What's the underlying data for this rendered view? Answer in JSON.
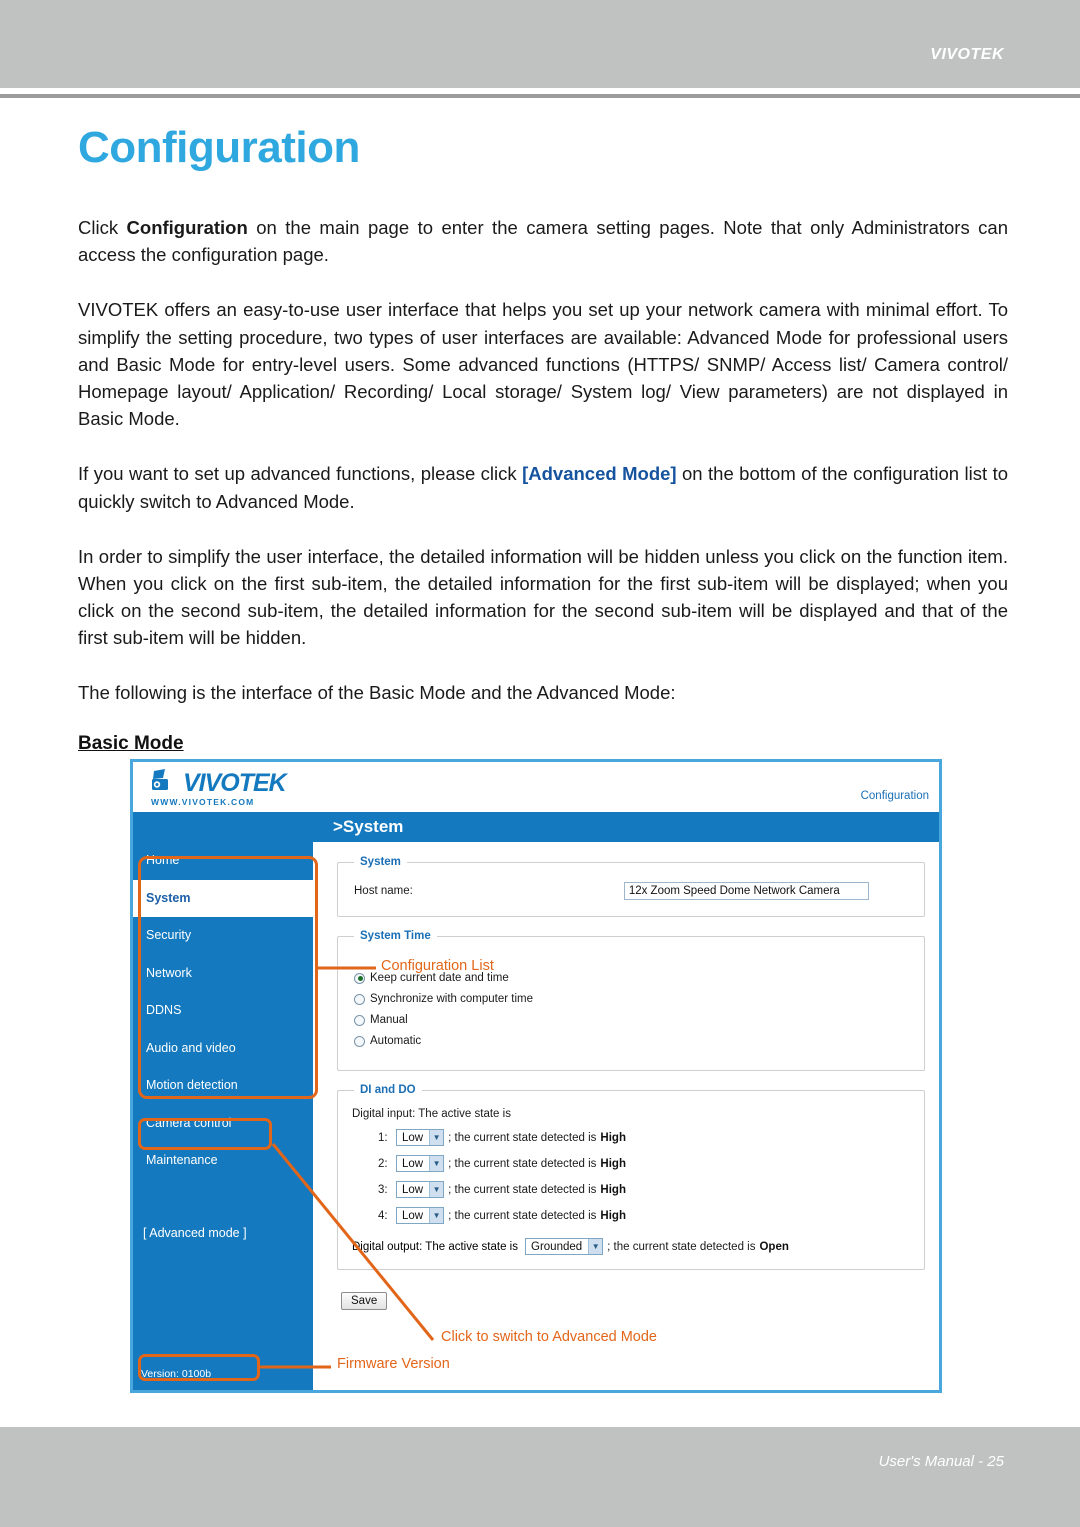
{
  "page_header": {
    "brand": "VIVOTEK"
  },
  "page_footer": {
    "manual": "User's Manual - 25"
  },
  "document": {
    "title": "Configuration",
    "paragraphs": [
      "Click Configuration on the main page to enter the camera setting pages. Note that only Administrators can access the configuration page.",
      "VIVOTEK offers an easy-to-use user interface that helps you set up your network camera with minimal effort. To simplify the setting procedure, two types of user interfaces are available: Advanced Mode for professional users and Basic Mode for entry-level users. Some advanced functions (HTTPS/ SNMP/ Access list/ Camera control/ Homepage layout/ Application/ Recording/ Local storage/ System log/ View parameters) are not displayed in Basic Mode.",
      "If you want to set up advanced functions, please click [Advanced Mode] on the bottom of the configuration list to quickly switch to Advanced Mode.",
      "In order to simplify the user interface, the detailed information will be hidden unless you click on the function item. When you click on the first sub-item, the detailed information for the first sub-item will be displayed; when you click on the second sub-item, the detailed information for the second sub-item will be displayed and that of the first sub-item will be hidden.",
      "The following is the interface of the Basic Mode and the Advanced Mode:"
    ],
    "p1_pre": "Click ",
    "p1_bold": "Configuration",
    "p1_post": " on the main page to enter the camera setting pages. Note that only Administrators can access the configuration page.",
    "p3_pre": "If you want to set up advanced functions, please click ",
    "p3_link": "[Advanced Mode]",
    "p3_post": " on the bottom of the configuration list to quickly switch to Advanced Mode.",
    "sub_heading": "Basic Mode"
  },
  "ui": {
    "logo": {
      "word": "VIVOTEK",
      "url": "WWW.VIVOTEK.COM"
    },
    "configuration_link": "Configuration",
    "breadcrumb": ">System",
    "sidebar": {
      "items": [
        {
          "label": "Home",
          "active": false
        },
        {
          "label": "System",
          "active": true
        },
        {
          "label": "Security",
          "active": false
        },
        {
          "label": "Network",
          "active": false
        },
        {
          "label": "DDNS",
          "active": false
        },
        {
          "label": "Audio and video",
          "active": false
        },
        {
          "label": "Motion detection",
          "active": false
        },
        {
          "label": "Camera control",
          "active": false
        },
        {
          "label": "Maintenance",
          "active": false
        }
      ],
      "advanced_mode": "[ Advanced mode ]",
      "version": "Version: 0100b"
    },
    "system_group": {
      "legend": "System",
      "host_label": "Host name:",
      "host_value": "12x Zoom Speed Dome Network Camera"
    },
    "system_time_group": {
      "legend": "System Time",
      "options": [
        {
          "label": "Keep current date and time",
          "selected": true
        },
        {
          "label": "Synchronize with computer time",
          "selected": false
        },
        {
          "label": "Manual",
          "selected": false
        },
        {
          "label": "Automatic",
          "selected": false
        }
      ]
    },
    "di_do_group": {
      "legend": "DI and DO",
      "di_lead": "Digital input: The active state is",
      "di_rows": [
        {
          "index": "1:",
          "select_value": "Low",
          "tail": "; the current state detected is",
          "state": "High"
        },
        {
          "index": "2:",
          "select_value": "Low",
          "tail": "; the current state detected is",
          "state": "High"
        },
        {
          "index": "3:",
          "select_value": "Low",
          "tail": "; the current state detected is",
          "state": "High"
        },
        {
          "index": "4:",
          "select_value": "Low",
          "tail": "; the current state detected is",
          "state": "High"
        }
      ],
      "do_lead": "Digital output: The active state is",
      "do_select_value": "Grounded",
      "do_tail": "; the current state detected is",
      "do_state": "Open"
    },
    "save_button": "Save"
  },
  "annotations": {
    "configuration_list": "Configuration List",
    "click_advanced": "Click to switch to Advanced Mode",
    "firmware_version": "Firmware Version",
    "color": "#e2661a"
  },
  "colors": {
    "accent_blue": "#2fa8e0",
    "ui_blue": "#1479be",
    "annotation_orange": "#e2661a",
    "header_gray": "#c0c1c1",
    "link_blue": "#15539e"
  }
}
